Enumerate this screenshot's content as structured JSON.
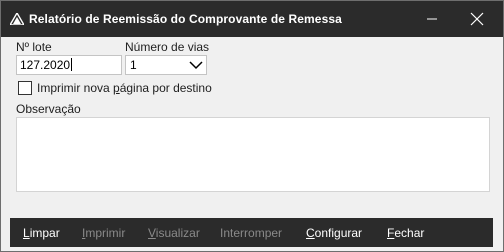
{
  "window": {
    "title": "Relatório de Reemissão do Comprovante de Remessa",
    "icons": {
      "app": "document-stack-icon",
      "minimize": "minimize-icon",
      "close": "close-icon"
    }
  },
  "form": {
    "lote_label": "Nº lote",
    "lote_value": "127.2020",
    "vias_label": "Número de vias",
    "vias_value": "1",
    "checkbox": {
      "checked": false,
      "pre": "Imprimir nova ",
      "mnemonic": "p",
      "post": "ágina por destino"
    },
    "obs_label": "Observação",
    "obs_value": ""
  },
  "actions": [
    {
      "mnemonic": "L",
      "rest": "impar",
      "enabled": true
    },
    {
      "mnemonic": "I",
      "rest": "mprimir",
      "enabled": false
    },
    {
      "mnemonic": "V",
      "rest": "isualizar",
      "enabled": false
    },
    {
      "mnemonic": "I",
      "rest": "nterromper",
      "enabled": false
    },
    {
      "mnemonic": "C",
      "rest": "onfigurar",
      "enabled": true
    },
    {
      "mnemonic": "F",
      "rest": "echar",
      "enabled": true
    }
  ],
  "colors": {
    "titlebar": "#2b2b2b",
    "toolbar": "#2b2b2b",
    "enabled_text": "#ffffff",
    "disabled_text": "#8a8a8a"
  }
}
